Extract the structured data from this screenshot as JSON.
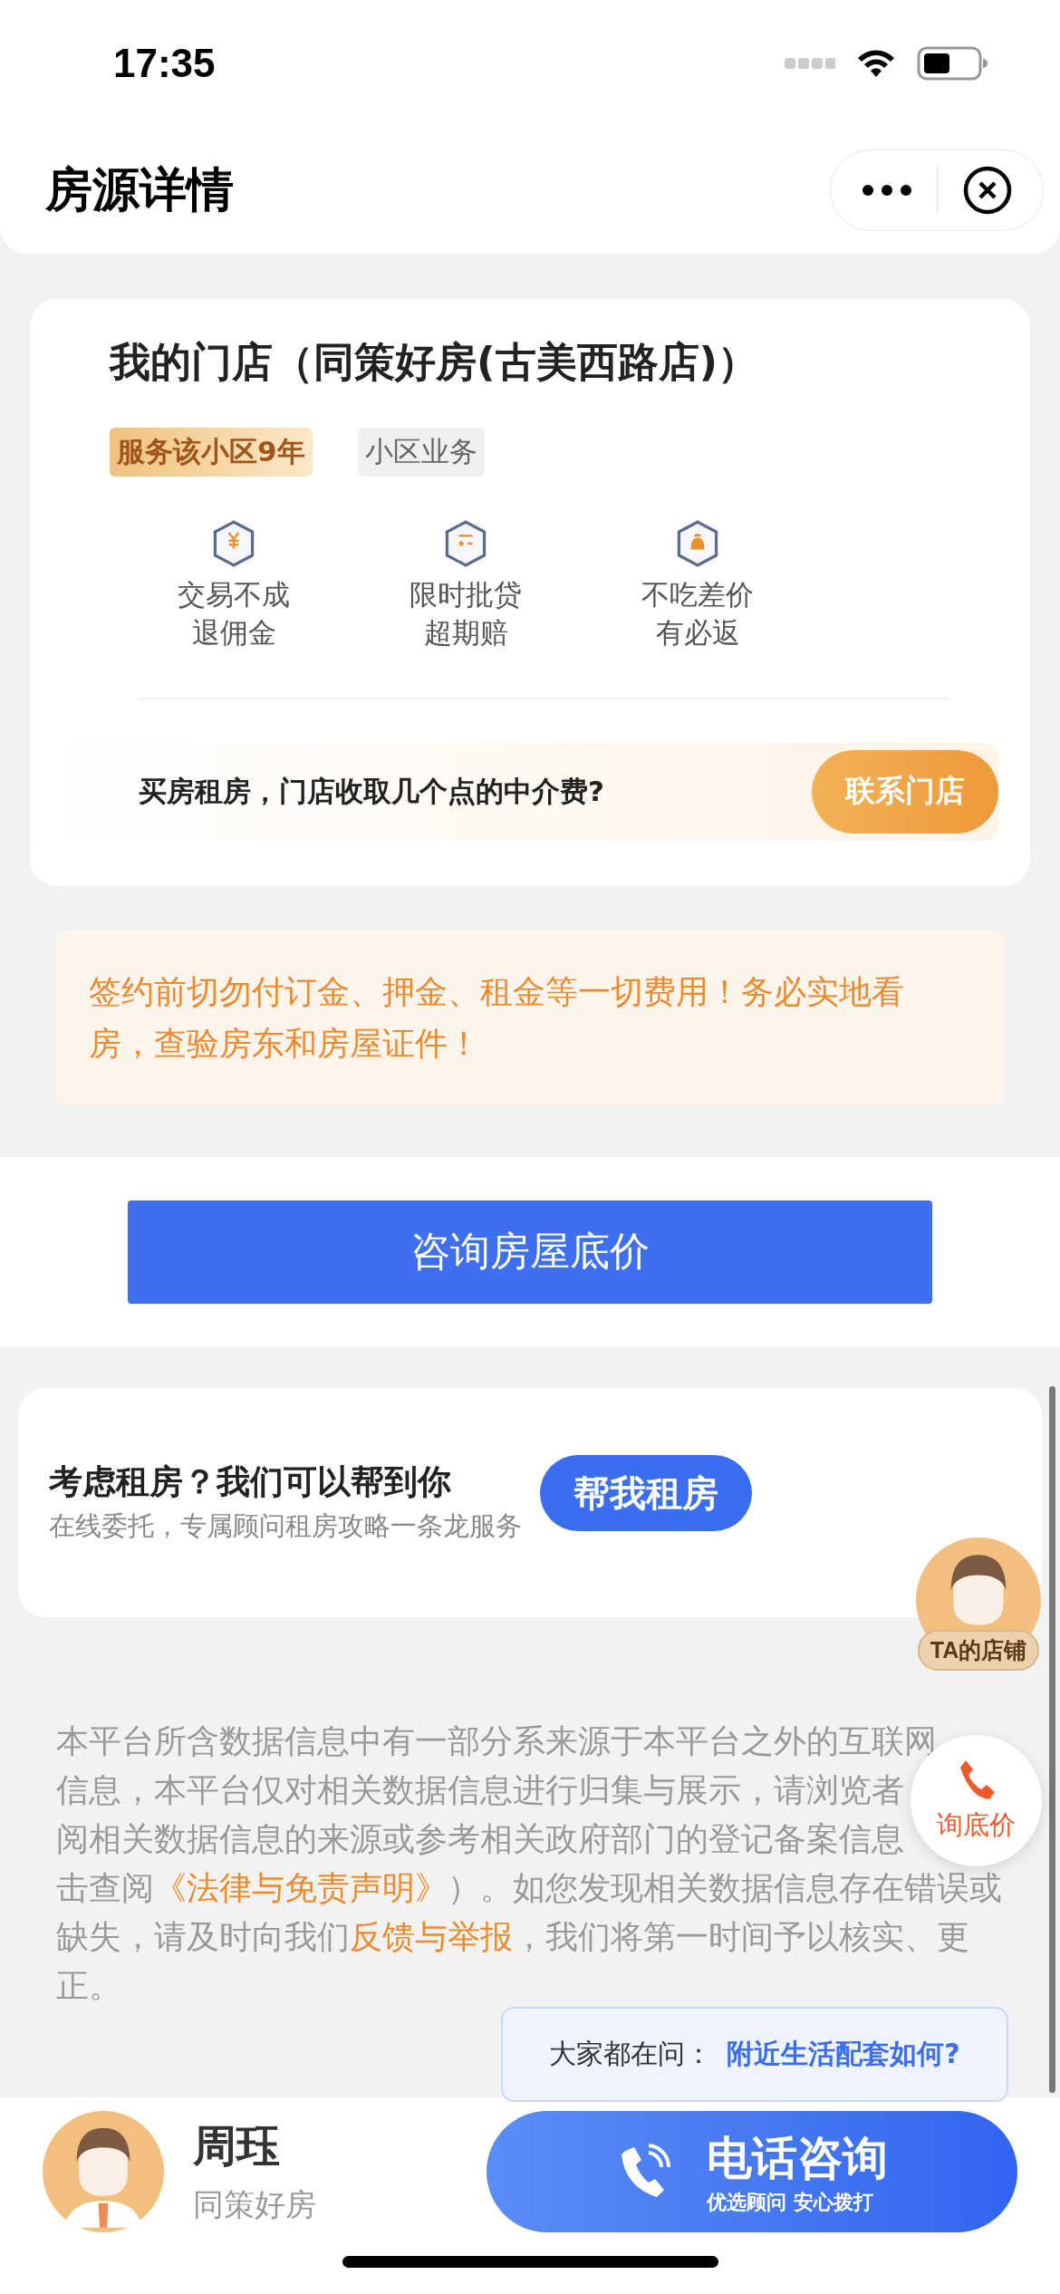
{
  "status_bar": {
    "time": "17:35"
  },
  "header": {
    "title": "房源详情"
  },
  "store": {
    "title": "我的门店（同策好房(古美西路店)）",
    "tags": [
      {
        "label": "服务该小区9年",
        "kind": "highlight"
      },
      {
        "label": "小区业务",
        "kind": "plain"
      }
    ],
    "features": [
      {
        "kind": "yuan",
        "lines": [
          "交易不成",
          "退佣金"
        ]
      },
      {
        "kind": "calc",
        "lines": [
          "限时批贷",
          "超期赔"
        ]
      },
      {
        "kind": "bag",
        "lines": [
          "不吃差价",
          "有必返"
        ]
      }
    ],
    "question": "买房租房，门店收取几个点的中介费?",
    "contact_button": "联系门店"
  },
  "warning": "签约前切勿付订金、押金、租金等一切费用！务必实地看房，查验房东和房屋证件！",
  "consult_button": "咨询房屋底价",
  "rent_card": {
    "title": "考虑租房？我们可以帮到你",
    "subtitle": "在线委托，专属顾问租房攻略一条龙服务",
    "button": "帮我租房"
  },
  "disclaimer": {
    "lines": [
      [
        {
          "text": "本平台所含数据信息中有一部分系来源于本平台之外的互联网",
          "link": false
        }
      ],
      [
        {
          "text": "信息，本平台仅对相关数据信息进行归集与展示，请浏览者",
          "link": false
        }
      ],
      [
        {
          "text": "阅相关数据信息的来源或参考相关政府部门的登记备案信息",
          "link": false
        }
      ],
      [
        {
          "text": "击查阅",
          "link": false
        },
        {
          "text": "《法律与免责声明》",
          "link": true
        },
        {
          "text": "）。如您发现相关数据信息存在错误或",
          "link": false
        }
      ],
      [
        {
          "text": "缺失，请及时向我们",
          "link": false
        },
        {
          "text": "反馈与举报",
          "link": true
        },
        {
          "text": "，我们将第一时间予以核实、更",
          "link": false
        }
      ],
      [
        {
          "text": "正。",
          "link": false
        }
      ]
    ]
  },
  "floating": {
    "shop_label": "TA的店铺",
    "price_label": "询底价"
  },
  "tooltip": {
    "prefix": "大家都在问：",
    "question": "附近生活配套如何?"
  },
  "agent": {
    "name": "周珏",
    "company": "同策好房"
  },
  "call_button": {
    "title": "电话咨询",
    "subtitle": "优选顾问 安心拨打"
  }
}
